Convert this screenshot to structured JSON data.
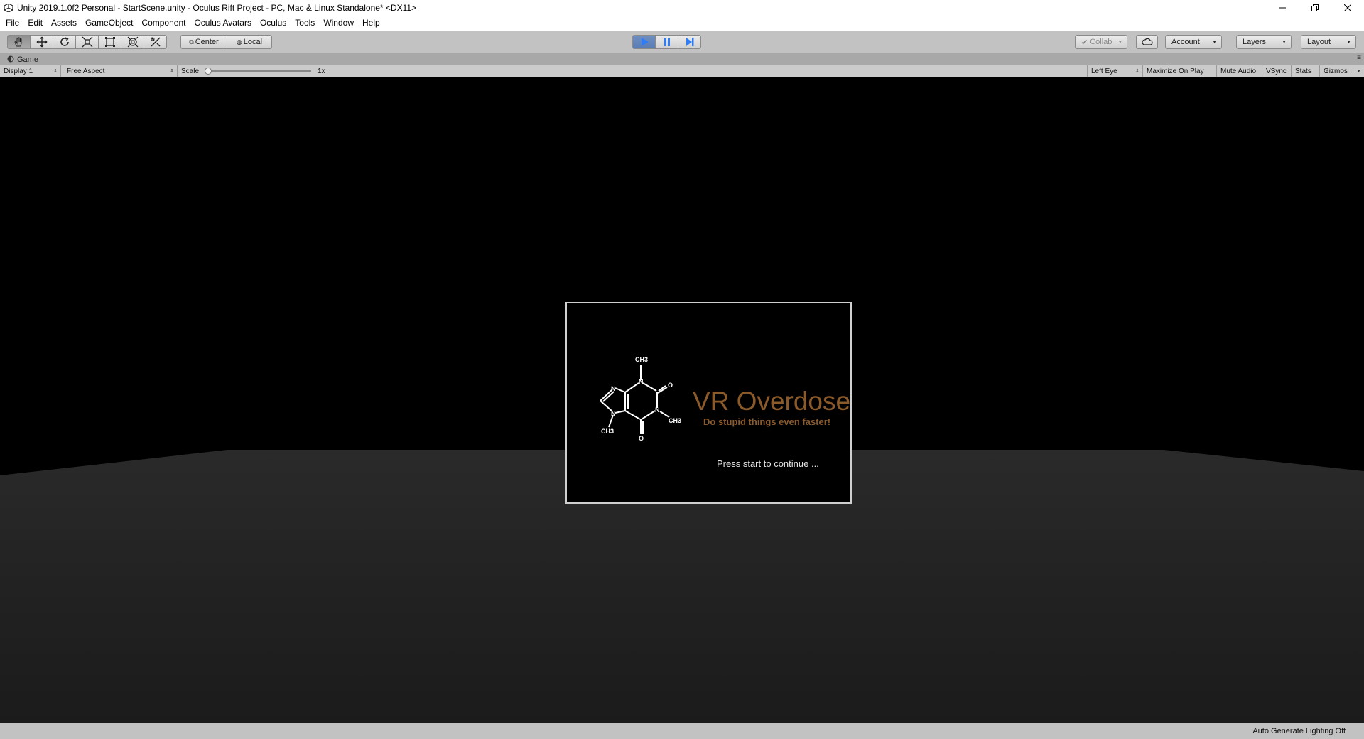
{
  "window": {
    "title": "Unity 2019.1.0f2 Personal - StartScene.unity - Oculus Rift Project - PC, Mac & Linux Standalone* <DX11>",
    "controls": [
      "minimize-icon",
      "restore-icon",
      "close-icon"
    ]
  },
  "menu": {
    "items": [
      "File",
      "Edit",
      "Assets",
      "GameObject",
      "Component",
      "Oculus Avatars",
      "Oculus",
      "Tools",
      "Window",
      "Help"
    ]
  },
  "toolbar": {
    "tools": [
      "hand-tool-icon",
      "move-tool-icon",
      "rotate-tool-icon",
      "scale-tool-icon",
      "rect-tool-icon",
      "transform-tool-icon",
      "custom-tool-icon"
    ],
    "pivot_label": "Center",
    "space_label": "Local",
    "play_state": "playing",
    "collab_label": "Collab",
    "account_label": "Account",
    "layers_label": "Layers",
    "layout_label": "Layout"
  },
  "game_tab": {
    "label": "Game"
  },
  "game_bar": {
    "display": "Display 1",
    "aspect": "Free Aspect",
    "scale_label": "Scale",
    "scale_value": "1x",
    "eye": "Left Eye",
    "maximize": "Maximize On Play",
    "mute": "Mute Audio",
    "vsync": "VSync",
    "stats": "Stats",
    "gizmos": "Gizmos"
  },
  "splash": {
    "title": "VR Overdose",
    "tagline": "Do stupid things even faster!",
    "prompt": "Press start to continue ...",
    "molecule_labels": [
      "CH3",
      "N",
      "O",
      "N",
      "CH3",
      "N",
      "N",
      "CH3",
      "O"
    ],
    "colors": {
      "title": "#8b5a2b",
      "text": "#e5e5e5"
    }
  },
  "status": {
    "lighting": "Auto Generate Lighting Off"
  },
  "colors": {
    "floor_top": "#262626",
    "floor_bottom": "#1a1a1a",
    "play_accent": "#2f7df6"
  }
}
